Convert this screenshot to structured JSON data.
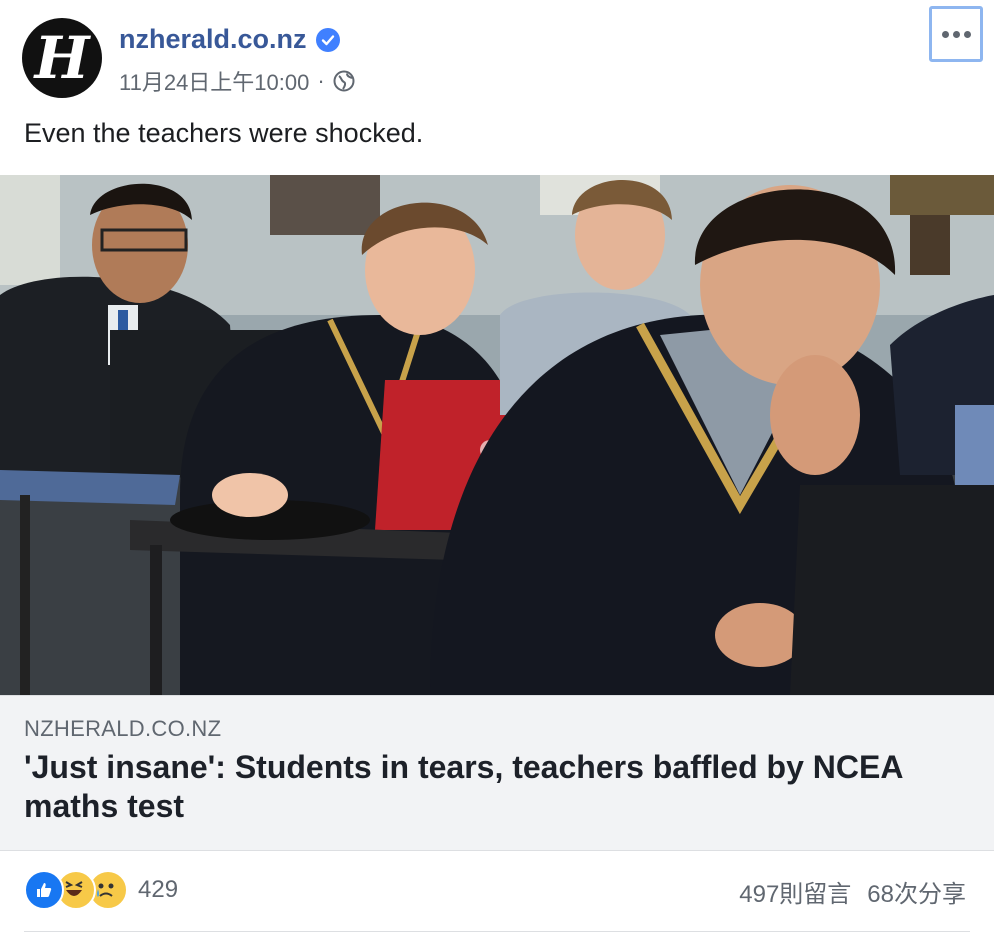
{
  "header": {
    "page_name": "nzherald.co.nz",
    "timestamp": "11月24日上午10:00",
    "separator": "·",
    "privacy_icon": "globe-icon",
    "verified_icon": "verified-badge-icon",
    "more_icon": "more-options-icon"
  },
  "post": {
    "text": "Even the teachers were shocked."
  },
  "link": {
    "image_description_icon": "photo",
    "domain": "NZHERALD.CO.NZ",
    "title": "'Just insane': Students in tears, teachers baffled by NCEA maths test"
  },
  "footer": {
    "reaction_icons": [
      "like-icon",
      "haha-icon",
      "sad-icon"
    ],
    "reaction_count": "429",
    "comments": "497則留言",
    "shares": "68次分享"
  },
  "colors": {
    "link_blue": "#385898",
    "verified_blue": "#4080ff",
    "meta_gray": "#606770",
    "link_bg": "#f2f3f5"
  }
}
